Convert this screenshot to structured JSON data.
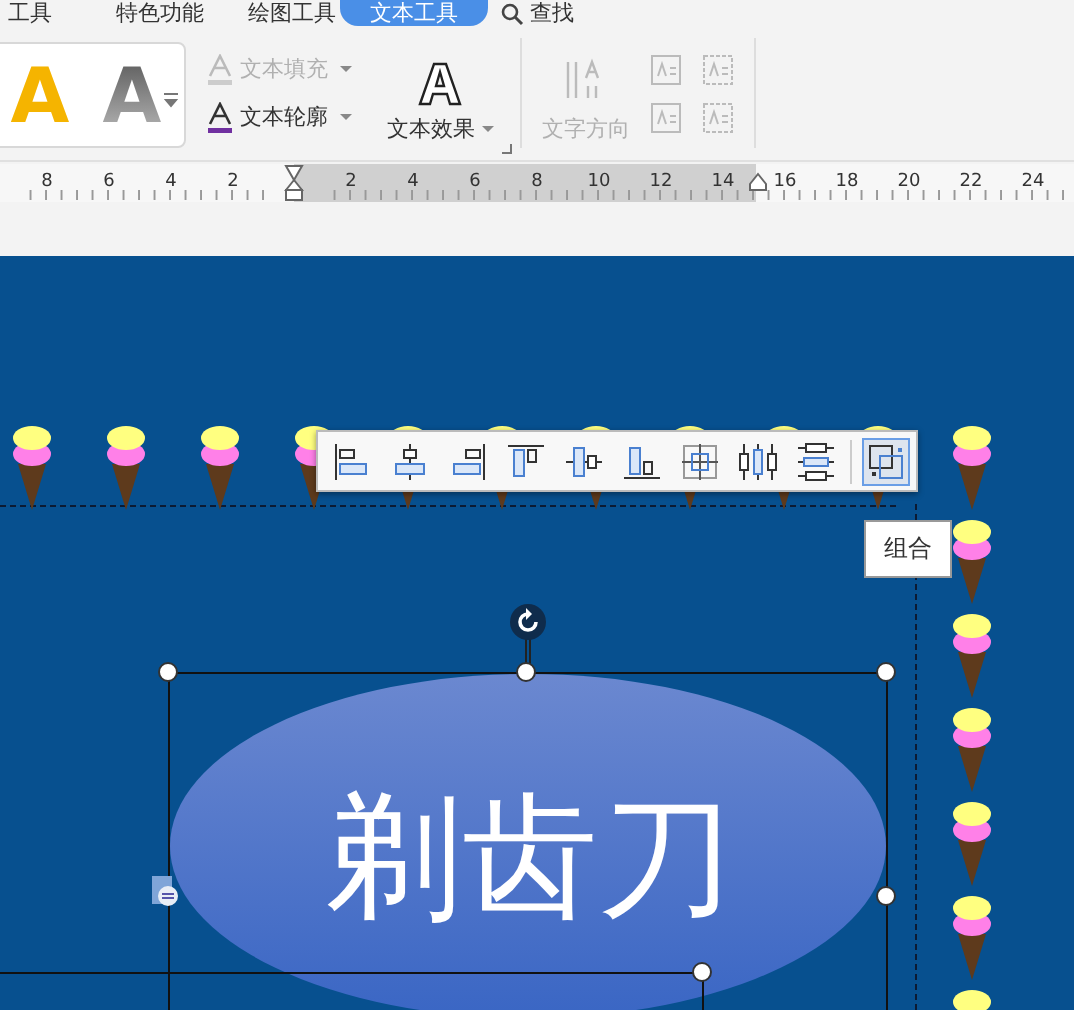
{
  "menu_tabs": [
    {
      "label": "工具",
      "selected": false
    },
    {
      "label": "特色功能",
      "selected": false
    },
    {
      "label": "绘图工具",
      "selected": false
    },
    {
      "label": "文本工具",
      "selected": true
    }
  ],
  "search": {
    "label": "查找"
  },
  "ribbon": {
    "style_gallery": [
      {
        "letter": "A",
        "kind": "gold"
      },
      {
        "letter": "A",
        "kind": "silver"
      }
    ],
    "commands": [
      {
        "label": "文本填充",
        "kind": "fill",
        "disabled": true
      },
      {
        "label": "文本轮廓",
        "kind": "outline",
        "disabled": false
      }
    ],
    "text_effect": {
      "label": "文本效果"
    },
    "text_direction": {
      "label": "文字方向",
      "disabled": true
    }
  },
  "ruler": {
    "left_marks": [
      "8",
      "6",
      "4",
      "2"
    ],
    "right_marks": [
      "2",
      "4",
      "6",
      "8",
      "10",
      "12",
      "14",
      "16",
      "18",
      "20",
      "22",
      "24"
    ]
  },
  "align_toolbar": {
    "buttons": [
      {
        "kind": "align-left",
        "selected": false
      },
      {
        "kind": "align-center",
        "selected": false
      },
      {
        "kind": "align-right",
        "selected": false
      },
      {
        "kind": "align-top",
        "selected": false
      },
      {
        "kind": "align-middle",
        "selected": false
      },
      {
        "kind": "align-bottom",
        "selected": false
      },
      {
        "kind": "align-slide-center",
        "selected": false
      },
      {
        "kind": "distribute-horizontal",
        "selected": false
      },
      {
        "kind": "distribute-vertical",
        "selected": false
      },
      {
        "kind": "group",
        "selected": true
      }
    ]
  },
  "tooltip": {
    "text": "组合"
  },
  "shape": {
    "text": "剃齿刀"
  }
}
